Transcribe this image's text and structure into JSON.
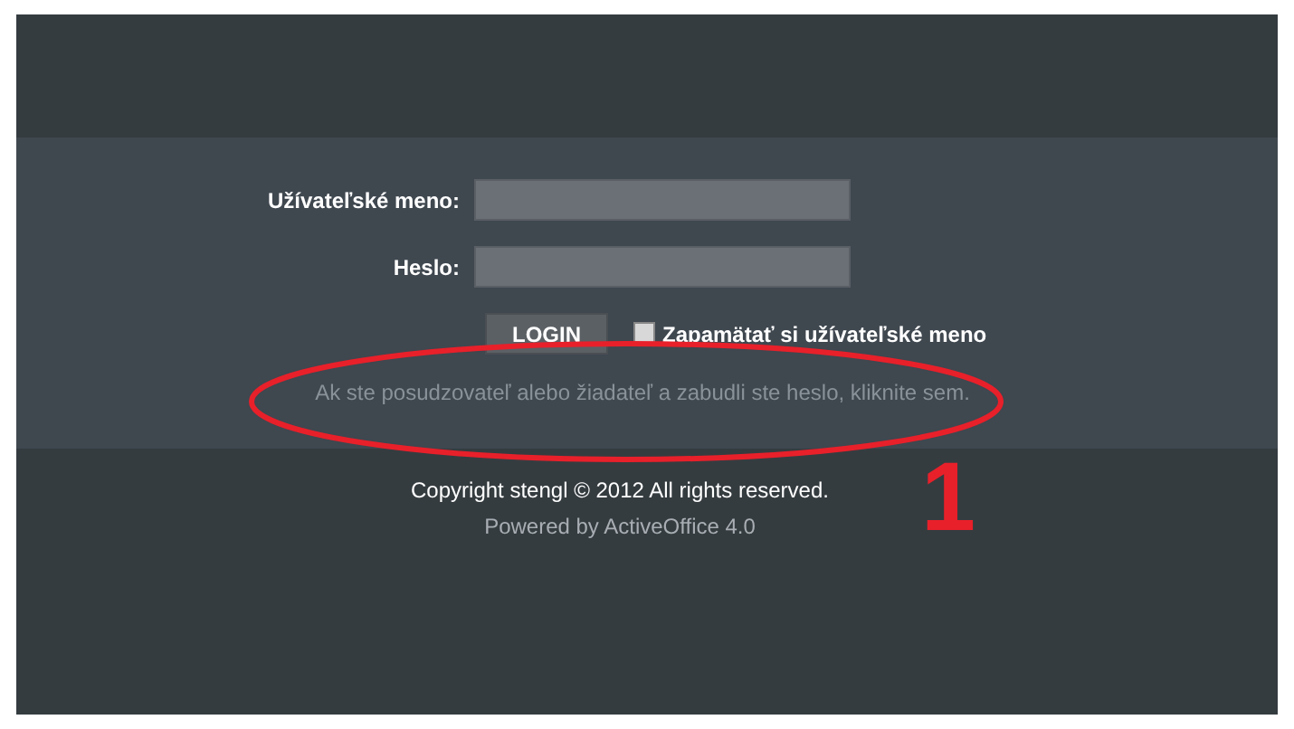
{
  "login_form": {
    "fields": [
      {
        "label": "Užívateľské meno:"
      },
      {
        "label": "Heslo:"
      }
    ],
    "login_button": "LOGIN",
    "remember": {
      "label": "Zapamätať si užívateľské meno",
      "checked": false
    },
    "forgot_link": "Ak ste posudzovateľ alebo žiadateľ a zabudli ste heslo, kliknite sem."
  },
  "footer": {
    "copyright": "Copyright stengl © 2012 All rights reserved.",
    "powered_by": "Powered by ActiveOffice 4.0"
  },
  "annotation": {
    "label": "1"
  }
}
